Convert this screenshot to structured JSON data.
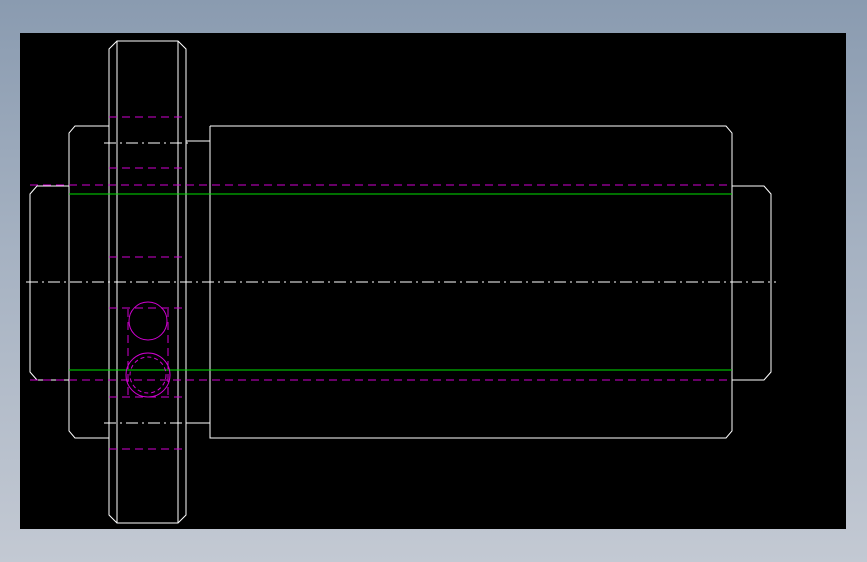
{
  "drawing": {
    "background": "#000000",
    "colors": {
      "outline": "#ffffff",
      "hidden": "#d000d0",
      "thread": "#00e000",
      "center": "#ffffff"
    },
    "line_styles": {
      "hidden": "dashed",
      "center": "dash-dot"
    }
  }
}
